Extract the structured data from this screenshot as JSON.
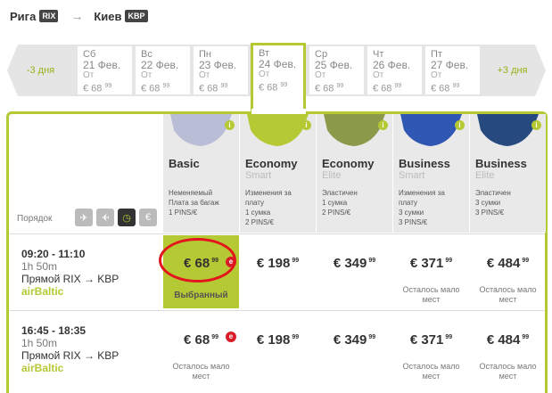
{
  "route": {
    "from": "Рига",
    "from_code": "RIX",
    "to": "Киев",
    "to_code": "KBP",
    "arrow": "→"
  },
  "dates": {
    "prev_label": "-3 дня",
    "next_label": "+3 дня",
    "days": [
      {
        "dname": "Сб",
        "ddate": "21 Фев.",
        "from": "От",
        "price": "€ 68",
        "cents": "99"
      },
      {
        "dname": "Вс",
        "ddate": "22 Фев.",
        "from": "От",
        "price": "€ 68",
        "cents": "99"
      },
      {
        "dname": "Пн",
        "ddate": "23 Фев.",
        "from": "От",
        "price": "€ 68",
        "cents": "99"
      },
      {
        "dname": "Вт",
        "ddate": "24 Фев.",
        "from": "От",
        "price": "€ 68",
        "cents": "99"
      },
      {
        "dname": "Ср",
        "ddate": "25 Фев.",
        "from": "От",
        "price": "€ 68",
        "cents": "99"
      },
      {
        "dname": "Чт",
        "ddate": "26 Фев.",
        "from": "От",
        "price": "€ 68",
        "cents": "99"
      },
      {
        "dname": "Пт",
        "ddate": "27 Фев.",
        "from": "От",
        "price": "€ 68",
        "cents": "99"
      }
    ]
  },
  "fares": [
    {
      "name": "Basic",
      "sub": "",
      "desc": "Неменяемый\nПлата за багаж\n1 PINS/€",
      "color": "#b9bdd6",
      "info": "i"
    },
    {
      "name": "Economy",
      "sub": "Smart",
      "desc": "Изменения за\nплату\n1 сумка\n2 PINS/€",
      "color": "#b5c934",
      "info": "i"
    },
    {
      "name": "Economy",
      "sub": "Elite",
      "desc": "Эластичен\n1 сумка\n2 PINS/€",
      "color": "#8a9a4a",
      "info": "i"
    },
    {
      "name": "Business",
      "sub": "Smart",
      "desc": "Изменения за\nплату\n3 сумки\n3 PINS/€",
      "color": "#2f57b3",
      "info": "i"
    },
    {
      "name": "Business",
      "sub": "Elite",
      "desc": "Эластичен\n3 сумки\n3 PINS/€",
      "color": "#264a80",
      "info": "i"
    }
  ],
  "sort": {
    "label": "Порядок",
    "icons": [
      "✈",
      "✈",
      "◷",
      "€"
    ]
  },
  "flights": [
    {
      "times": "09:20 - 11:10",
      "duration": "1h 50m",
      "type": "Прямой RIX → KBP",
      "airline": "airBaltic",
      "prices": [
        {
          "price": "€ 68",
          "cents": "99",
          "note": "Выбранный"
        },
        {
          "price": "€ 198",
          "cents": "99",
          "note": ""
        },
        {
          "price": "€ 349",
          "cents": "99",
          "note": ""
        },
        {
          "price": "€ 371",
          "cents": "99",
          "note": "Осталось мало\nмест"
        },
        {
          "price": "€ 484",
          "cents": "99",
          "note": "Осталось мало\nмест"
        }
      ]
    },
    {
      "times": "16:45 - 18:35",
      "duration": "1h 50m",
      "type": "Прямой RIX → KBP",
      "airline": "airBaltic",
      "prices": [
        {
          "price": "€ 68",
          "cents": "99",
          "note": "Осталось мало\nмест"
        },
        {
          "price": "€ 198",
          "cents": "99",
          "note": ""
        },
        {
          "price": "€ 349",
          "cents": "99",
          "note": ""
        },
        {
          "price": "€ 371",
          "cents": "99",
          "note": "Осталось мало\nмест"
        },
        {
          "price": "€ 484",
          "cents": "99",
          "note": "Осталось мало\nмест"
        }
      ]
    }
  ],
  "badge": "e"
}
